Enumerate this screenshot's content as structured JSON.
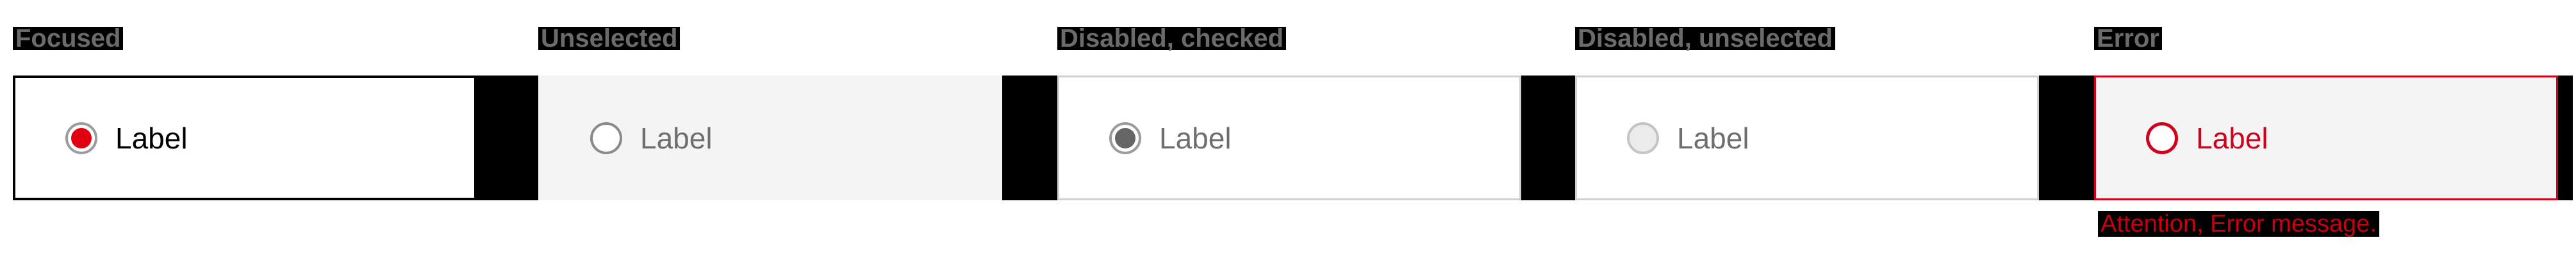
{
  "states": [
    {
      "key": "focused",
      "title": "Focused",
      "option_label": "Label",
      "checked": true,
      "radio_border": "#9b9b9b",
      "radio_fill": "#e0000f",
      "label_color": "#000000"
    },
    {
      "key": "unselected",
      "title": "Unselected",
      "option_label": "Label",
      "checked": false,
      "radio_border": "#8a8a8a",
      "radio_fill": "",
      "label_color": "#6e6e6e"
    },
    {
      "key": "disabled-checked",
      "title": "Disabled, checked",
      "option_label": "Label",
      "checked": true,
      "radio_border": "#9b9b9b",
      "radio_fill": "#666666",
      "label_color": "#6e6e6e"
    },
    {
      "key": "disabled-unselected",
      "title": "Disabled, unselected",
      "option_label": "Label",
      "checked": false,
      "radio_border": "#c4c4c4",
      "radio_fill": "",
      "label_color": "#6e6e6e"
    },
    {
      "key": "error",
      "title": "Error",
      "option_label": "Label",
      "checked": false,
      "radio_border": "#d0021b",
      "radio_fill": "",
      "label_color": "#d0021b",
      "error_message": "Attention, Error message."
    }
  ],
  "colors": {
    "accent": "#e0000f",
    "error": "#d0021b",
    "disabled_fill": "#666666"
  }
}
